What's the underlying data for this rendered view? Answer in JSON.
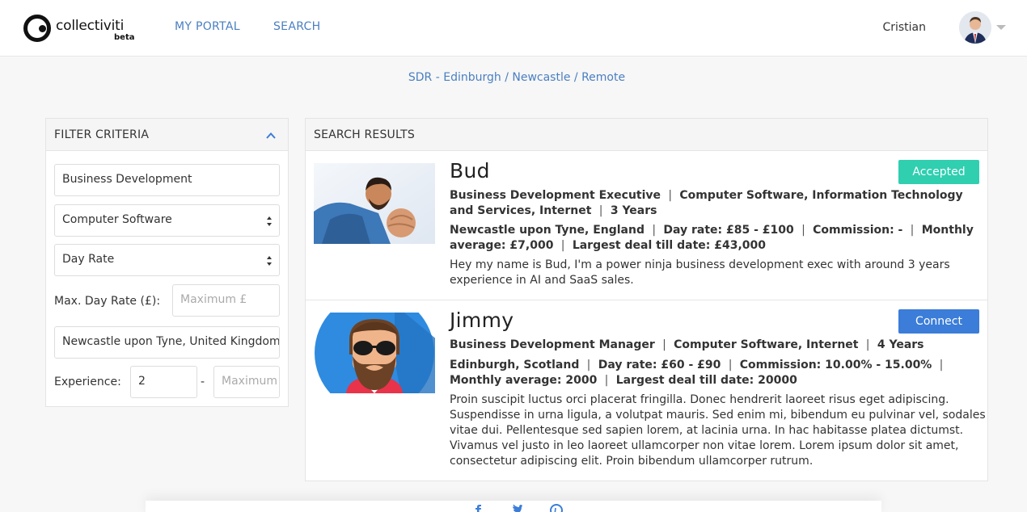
{
  "header": {
    "logo_text": "collectiviti",
    "logo_beta": "beta",
    "nav": [
      {
        "label": "MY PORTAL"
      },
      {
        "label": "SEARCH"
      }
    ],
    "user_name": "Cristian"
  },
  "breadcrumb": "SDR - Edinburgh / Newcastle / Remote",
  "filter": {
    "title": "FILTER CRITERIA",
    "keyword_value": "Business Development",
    "industry_value": "Computer Software",
    "rate_type_value": "Day Rate",
    "max_day_rate_label": "Max. Day Rate (£):",
    "max_day_rate_placeholder": "Maximum £",
    "location_value": "Newcastle upon Tyne, United Kingdom",
    "experience_label": "Experience:",
    "experience_min_value": "2",
    "experience_separator": "-",
    "experience_max_placeholder": "Maximum"
  },
  "results": {
    "title": "SEARCH RESULTS",
    "items": [
      {
        "name": "Bud",
        "title": "Business Development Executive",
        "industries": "Computer Software, Information Technology and Services, Internet",
        "years": "3 Years",
        "location": "Newcastle upon Tyne, England",
        "day_rate": "Day rate: £85 - £100",
        "commission": "Commission:  -",
        "monthly_average": "Monthly average: £7,000",
        "largest_deal": "Largest deal till date: £43,000",
        "description": "Hey my name is Bud, I'm a power ninja business development exec with around 3 years experience in AI and SaaS sales.",
        "button_label": "Accepted",
        "button_color": "#2fcfb0"
      },
      {
        "name": "Jimmy",
        "title": "Business Development Manager",
        "industries": "Computer Software, Internet",
        "years": "4 Years",
        "location": "Edinburgh, Scotland",
        "day_rate": "Day rate: £60 - £90",
        "commission": "Commission: 10.00% - 15.00%",
        "monthly_average": "Monthly average: 2000",
        "largest_deal": "Largest deal till date: 20000",
        "description": "Proin suscipit luctus orci placerat fringilla. Donec hendrerit laoreet risus eget adipiscing. Suspendisse in urna ligula, a volutpat mauris. Sed enim mi, bibendum eu pulvinar vel, sodales vitae dui. Pellentesque sed sapien lorem, at lacinia urna. In hac habitasse platea dictumst. Vivamus vel justo in leo laoreet ullamcorper non vitae lorem. Lorem ipsum dolor sit amet, consectetur adipiscing elit. Proin bibendum ullamcorper rutrum.",
        "button_label": "Connect",
        "button_color": "#3b7dd8"
      }
    ]
  },
  "colors": {
    "link": "#4a7fc1",
    "accepted": "#2fcfb0",
    "connect": "#3b7dd8"
  }
}
